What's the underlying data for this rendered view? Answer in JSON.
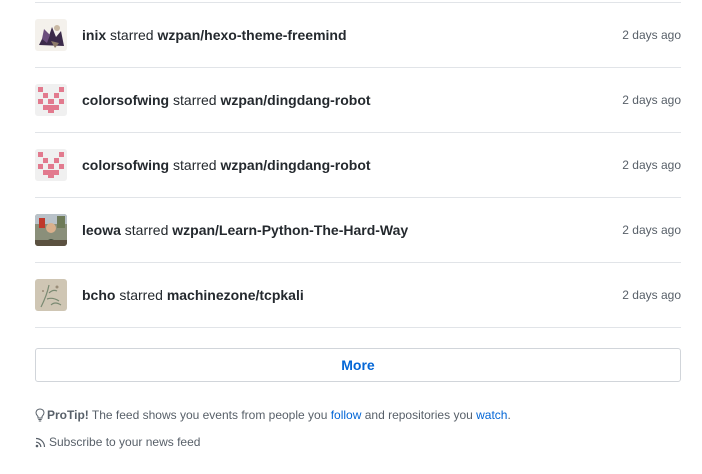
{
  "feed": {
    "items": [
      {
        "actor": "inix",
        "verb": "starred",
        "repo": "wzpan/hexo-theme-freemind",
        "time": "2 days ago",
        "avatar": "inix-avatar"
      },
      {
        "actor": "colorsofwing",
        "verb": "starred",
        "repo": "wzpan/dingdang-robot",
        "time": "2 days ago",
        "avatar": "identicon-pink"
      },
      {
        "actor": "colorsofwing",
        "verb": "starred",
        "repo": "wzpan/dingdang-robot",
        "time": "2 days ago",
        "avatar": "identicon-pink"
      },
      {
        "actor": "leowa",
        "verb": "starred",
        "repo": "wzpan/Learn-Python-The-Hard-Way",
        "time": "2 days ago",
        "avatar": "photo-avatar"
      },
      {
        "actor": "bcho",
        "verb": "starred",
        "repo": "machinezone/tcpkali",
        "time": "2 days ago",
        "avatar": "sketch-avatar"
      }
    ]
  },
  "more_label": "More",
  "protip": {
    "title": "ProTip!",
    "text_before": " The feed shows you events from people you ",
    "follow_link": "follow",
    "text_middle": " and repositories you ",
    "watch_link": "watch",
    "text_after": "."
  },
  "subscribe_label": "Subscribe to your news feed",
  "colors": {
    "link": "#0366d6",
    "muted": "#586069",
    "border": "#e1e4e8",
    "identicon": "#e27a8e"
  }
}
